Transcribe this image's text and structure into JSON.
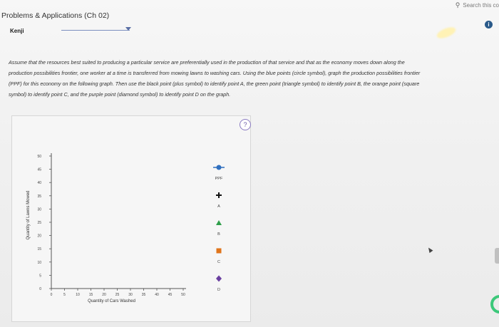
{
  "header": {
    "title": "Problems & Applications (Ch 02)",
    "search_placeholder": "Search this co",
    "name_label": "Kenji",
    "info_icon": "i"
  },
  "instructions": "Assume that the resources best suited to producing a particular service are preferentially used in the production of that service and that as the economy moves down along the production possibilities frontier, one worker at a time is transferred from mowing lawns to washing cars. Using the blue points (circle symbol), graph the production possibilities frontier (PPF) for this economy on the following graph. Then use the black point (plus symbol) to identify point A, the green point (triangle symbol) to identify point B, the orange point (square symbol) to identify point C, and the purple point (diamond symbol) to identify point D on the graph.",
  "help_label": "?",
  "chart_data": {
    "type": "scatter",
    "xlabel": "Quantity of Cars Washed",
    "ylabel": "Quantity of Lawns Mowed",
    "xlim": [
      0,
      50
    ],
    "ylim": [
      0,
      50
    ],
    "x_ticks": [
      "0",
      "5",
      "10",
      "15",
      "20",
      "25",
      "30",
      "35",
      "40",
      "45",
      "50"
    ],
    "y_ticks": [
      "0",
      "5",
      "10",
      "15",
      "20",
      "25",
      "30",
      "35",
      "40",
      "45",
      "50"
    ],
    "grid": false,
    "series": []
  },
  "legend": [
    {
      "label": "PPF",
      "symbol": "circle-line",
      "color": "#2f6fbf"
    },
    {
      "label": "A",
      "symbol": "plus",
      "color": "#111111"
    },
    {
      "label": "B",
      "symbol": "triangle",
      "color": "#2e9e4a"
    },
    {
      "label": "C",
      "symbol": "square",
      "color": "#e0741b"
    },
    {
      "label": "D",
      "symbol": "diamond",
      "color": "#6a3fa0"
    }
  ]
}
